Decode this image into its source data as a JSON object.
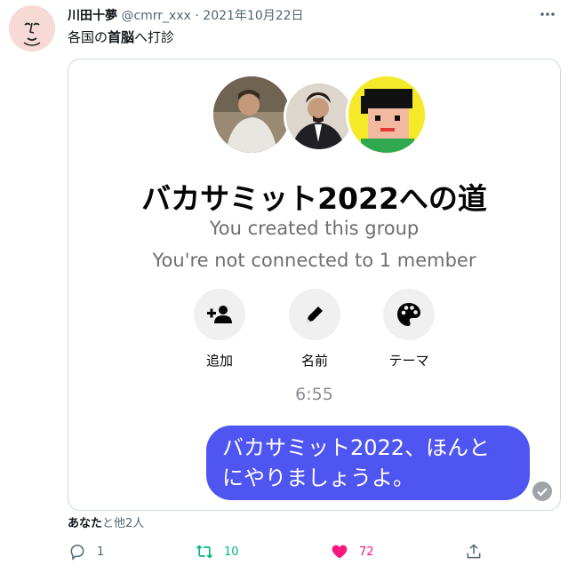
{
  "tweet": {
    "author_name": "川田十夢",
    "handle": "@cmrr_xxx",
    "separator": " · ",
    "date": "2021年10月22日",
    "text_pre": "各国の",
    "text_bold": "首脳",
    "text_post": "へ打診"
  },
  "chat": {
    "group_title": "バカサミット2022への道",
    "created_text": "You created this group",
    "not_connected_text": "You're not connected to 1 member",
    "actions": [
      {
        "label": "追加",
        "icon": "add-person-icon"
      },
      {
        "label": "名前",
        "icon": "pencil-icon"
      },
      {
        "label": "テーマ",
        "icon": "palette-icon"
      }
    ],
    "time": "6:55",
    "message_line1": "バカサミット2022、ほんと",
    "message_line2": "にやりましょうよ。",
    "bubble_color": "#4f55f0"
  },
  "likes": {
    "you": "あなた",
    "rest": "と他2人"
  },
  "stats": {
    "replies": "1",
    "retweets": "10",
    "likes": "72"
  },
  "colors": {
    "retweet": "#00ba7c",
    "like": "#f91880",
    "muted": "#536471"
  }
}
